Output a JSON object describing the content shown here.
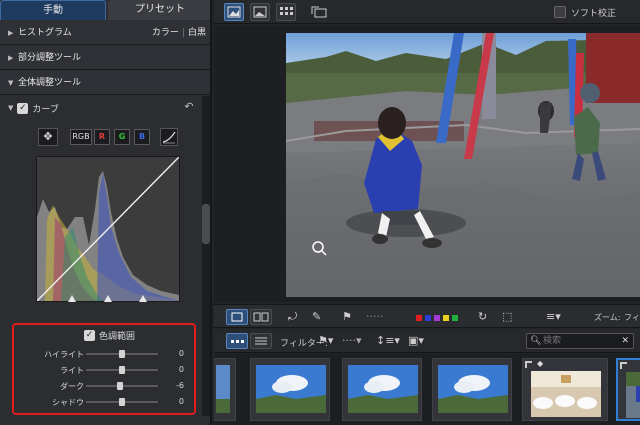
{
  "tabs": [
    {
      "label": "手動",
      "active": true
    },
    {
      "label": "プリセット",
      "active": false
    }
  ],
  "histogram": {
    "label": "ヒストグラム",
    "mode_color": "カラー",
    "mode_bw": "白黒"
  },
  "sections": {
    "partial": "部分調整ツール",
    "overall": "全体調整ツール"
  },
  "curve": {
    "label": "カーブ",
    "channels": [
      {
        "label": "RGB",
        "color": "#e0e0e0"
      },
      {
        "label": "R",
        "color": "#e23b3b"
      },
      {
        "label": "G",
        "color": "#3bc23b"
      },
      {
        "label": "B",
        "color": "#3b6be2"
      }
    ]
  },
  "color_range": {
    "label": "色調範囲",
    "sliders": [
      {
        "label": "ハイライト",
        "value": "0",
        "position": 0.5
      },
      {
        "label": "ライト",
        "value": "0",
        "position": 0.5
      },
      {
        "label": "ダーク",
        "value": "-6",
        "position": 0.47
      },
      {
        "label": "シャドウ",
        "value": "0",
        "position": 0.5
      }
    ],
    "highlight_color": "#e21b1b"
  },
  "toolbar": {
    "soft_proof": "ソフト校正"
  },
  "toolstrip": {
    "zoom_label": "ズーム:",
    "zoom_value": "フィ"
  },
  "filter": {
    "label": "フィルター:",
    "search_placeholder": "検索"
  },
  "color_labels": [
    "#e02020",
    "#2a3fd0",
    "#a63ad6",
    "#e8d020",
    "#20b040"
  ],
  "accent": "#2f7fd6"
}
